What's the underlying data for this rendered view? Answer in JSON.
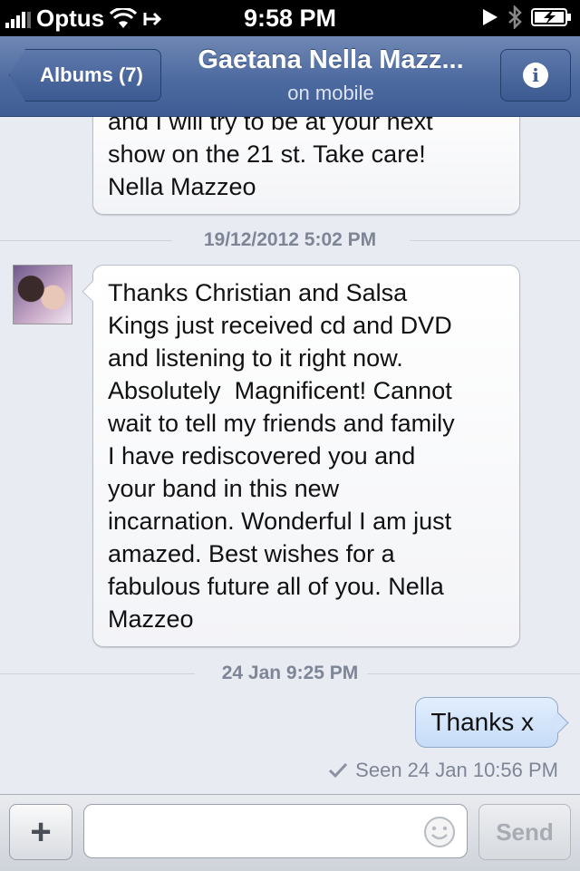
{
  "status_bar": {
    "carrier": "Optus",
    "time": "9:58 PM"
  },
  "nav": {
    "back_label": "Albums (7)",
    "title": "Gaetana Nella Mazz...",
    "subtitle": "on mobile",
    "info_icon": "info-icon"
  },
  "messages": {
    "partial_lines": [
      "and I will try to be at your next",
      "show on the 21 st. Take care!",
      "Nella Mazzeo"
    ],
    "timestamp_1": "19/12/2012 5:02 PM",
    "message_2_lines": [
      "Thanks Christian and Salsa",
      "Kings just received cd and DVD",
      "and listening to it right now.",
      "Absolutely  Magnificent! Cannot",
      "wait to tell my friends and family",
      "I have rediscovered you and",
      "your band in this new",
      "incarnation. Wonderful I am just",
      "amazed. Best wishes for a",
      "fabulous future all of you. Nella",
      "Mazzeo"
    ],
    "timestamp_2": "24 Jan 9:25 PM",
    "outgoing": "Thanks x",
    "seen": "Seen 24 Jan 10:56 PM"
  },
  "composer": {
    "add_label": "+",
    "input_value": "",
    "send_label": "Send"
  },
  "colors": {
    "nav_blue": "#4d6aa0",
    "outgoing_bubble": "#c6dcf7",
    "background": "#e8ebf1"
  }
}
